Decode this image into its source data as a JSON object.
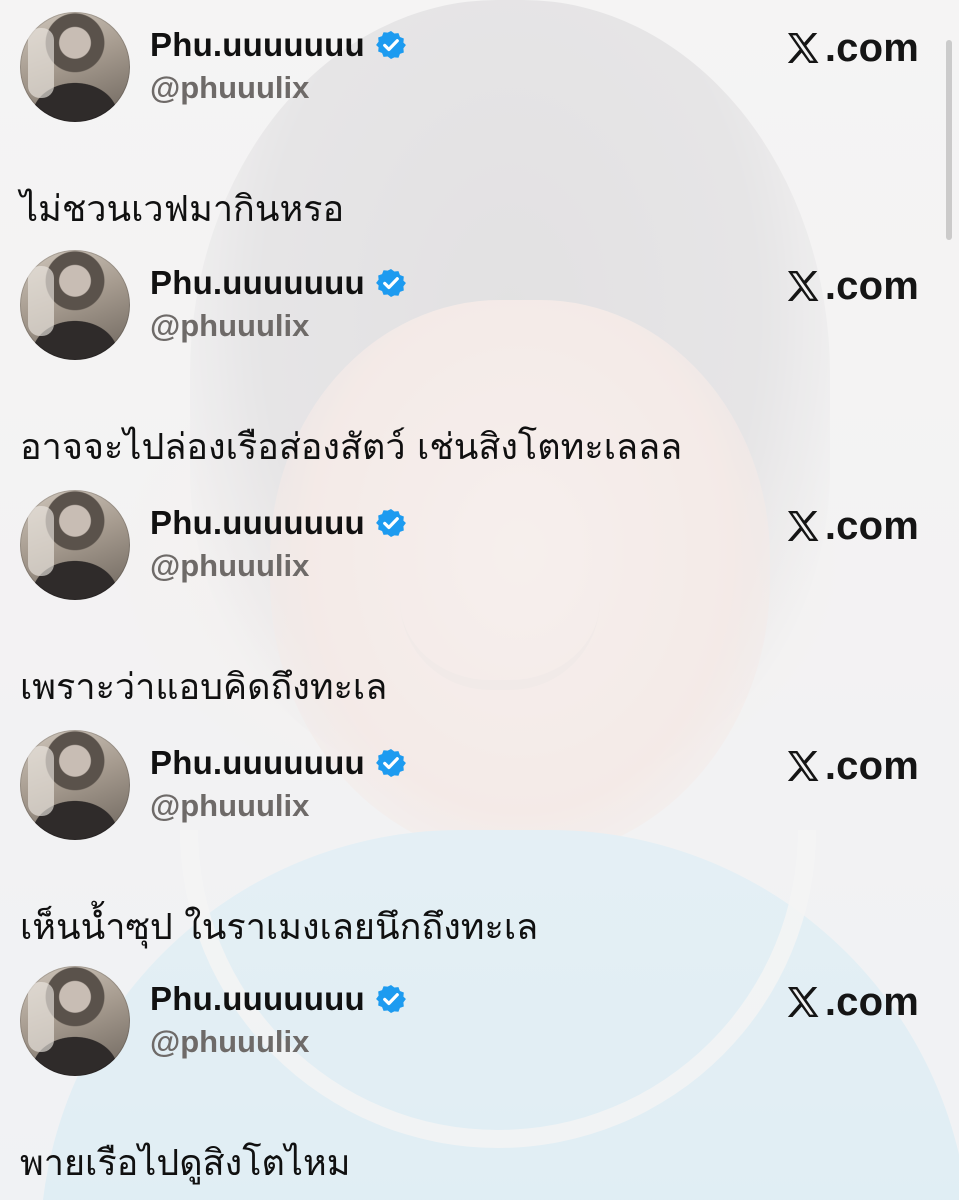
{
  "colors": {
    "verified_badge": "#1d9bf0",
    "text": "#111111",
    "handle": "#6e6a68"
  },
  "brand": {
    "logo_icon": "x-logo-icon",
    "text": ".com"
  },
  "tweets": [
    {
      "display_name": "Phu.uuuuuuu",
      "handle": "@phuuulix",
      "text": "ไม่ชวนเวฟมากินหรอ"
    },
    {
      "display_name": "Phu.uuuuuuu",
      "handle": "@phuuulix",
      "text": "อาจจะไปล่องเรือส่องสัตว์ เช่นสิงโตทะเลลล"
    },
    {
      "display_name": "Phu.uuuuuuu",
      "handle": "@phuuulix",
      "text": "เพราะว่าแอบคิดถึงทะเล"
    },
    {
      "display_name": "Phu.uuuuuuu",
      "handle": "@phuuulix",
      "text": "เห็นน้ำซุป ในราเมงเลยนึกถึงทะเล"
    },
    {
      "display_name": "Phu.uuuuuuu",
      "handle": "@phuuulix",
      "text": "พายเรือไปดูสิงโตไหม"
    }
  ]
}
